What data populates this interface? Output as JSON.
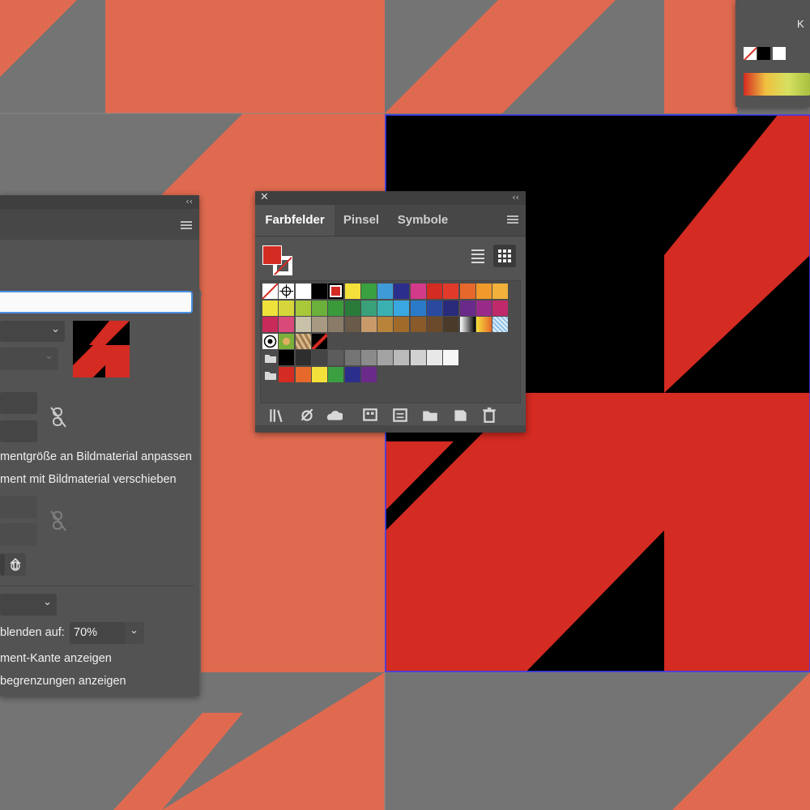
{
  "artwork": {
    "orange": "#e06a50",
    "gray": "#747474",
    "darkgray": "#6d6d6d",
    "red": "#d42b22",
    "black": "#000000",
    "artboard_border": "#3a3aff"
  },
  "top_right_panel": {
    "channel_label": "K"
  },
  "swatches_panel": {
    "tabs": [
      {
        "label": "Farbfelder",
        "active": true
      },
      {
        "label": "Pinsel",
        "active": false
      },
      {
        "label": "Symbole",
        "active": false
      }
    ],
    "fill_color": "#d42b22",
    "view_modes": [
      "list-view",
      "grid-view"
    ],
    "rows": [
      [
        "none",
        "registration",
        "#ffffff",
        "#000000",
        "#d42b22-selected",
        "#f4e03a",
        "#3aa040",
        "#3f9ad8",
        "#2c2e8c",
        "#d43a8a",
        "#d42b22",
        "#e23a2a",
        "#e6682a",
        "#ef9a2a",
        "#f1b13a"
      ],
      [
        "#efe23a",
        "#d6d63a",
        "#a8c83a",
        "#6ab03a",
        "#3a9a3a",
        "#2a7a3a",
        "#3aa07a",
        "#3ab0b0",
        "#3aa8e0",
        "#2a7ac8",
        "#2a4aa0",
        "#2a2a7a",
        "#6a2a8a",
        "#9a2a8a",
        "#c02a6a"
      ],
      [
        "#c82a5a",
        "#d84a7a",
        "#c8c0a8",
        "#a89a82",
        "#8a7a68",
        "#6a5a4a",
        "#c89a6a",
        "#b8843a",
        "#a06a2a",
        "#8a5a2a",
        "#6a4a2a",
        "#4a3a2a",
        "gradient-bw",
        "gradient-yellow",
        "pattern-blue"
      ],
      [
        "pattern-circles",
        "pattern-leaves",
        "pattern-brown",
        "pattern-selected"
      ],
      [
        "folder",
        "#000000",
        "#2e2e2e",
        "#454545",
        "#5c5c5c",
        "#747474",
        "#8b8b8b",
        "#a3a3a3",
        "#bababa",
        "#d1d1d1",
        "#e8e8e8",
        "#f7f7f7"
      ],
      [
        "folder",
        "#d42b22",
        "#e6682a",
        "#f4e03a",
        "#3aa040",
        "#2c2e8c",
        "#6a2a8a"
      ]
    ],
    "footer_icons": [
      "libraries-icon",
      "swatch-kinds-icon",
      "cloud-icon",
      "swatch-options-icon",
      "list-icon",
      "new-group-icon",
      "new-swatch-icon",
      "trash-icon"
    ]
  },
  "artboard_panel": {
    "options": {
      "fit_to_artwork": "mentgröße an Bildmaterial anpassen",
      "move_with_artwork": "ment mit Bildmaterial verschieben",
      "fade_label": "blenden auf:",
      "fade_value": "70%",
      "show_edge": "ment-Kante anzeigen",
      "show_bounds": "begrenzungen anzeigen"
    }
  }
}
